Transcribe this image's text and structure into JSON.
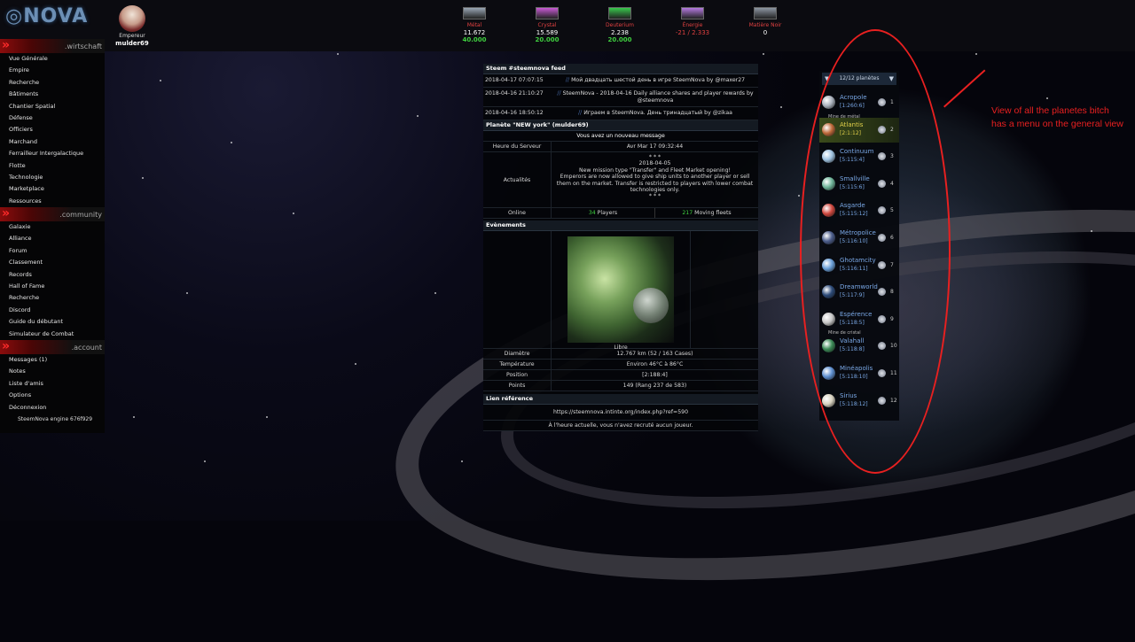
{
  "header": {
    "logo": "NOVA",
    "user_rank": "Empereur",
    "username": "mulder69",
    "resources": [
      {
        "name": "Métal",
        "value": "11.672",
        "prod": "40.000",
        "color": "#9aa7b5",
        "icon": "metal-icon"
      },
      {
        "name": "Crystal",
        "value": "15.589",
        "prod": "20.000",
        "color": "#c95ad4",
        "icon": "crystal-icon"
      },
      {
        "name": "Deuterium",
        "value": "2.238",
        "prod": "20.000",
        "color": "#38c94c",
        "icon": "deuterium-icon"
      },
      {
        "name": "Énergie",
        "value": "-21 / 2.333",
        "prod": "",
        "color": "#b57ae0",
        "icon": "energy-icon"
      },
      {
        "name": "Matière Noir",
        "value": "0",
        "prod": "",
        "color": "#8d96a2",
        "icon": "dark-matter-icon"
      }
    ]
  },
  "sidebar": {
    "sections": [
      {
        "label": ".wirtschaft",
        "items": [
          "Vue Générale",
          "Empire",
          "Recherche",
          "Bâtiments",
          "Chantier Spatial",
          "Défense",
          "Officiers",
          "Marchand",
          "Ferrailleur Intergalactique",
          "Flotte",
          "Technologie",
          "Marketplace",
          "Ressources"
        ]
      },
      {
        "label": ".community",
        "items": [
          "Galaxie",
          "Alliance",
          "Forum",
          "Classement",
          "Records",
          "Hall of Fame",
          "Recherche",
          "Discord",
          "Guide du débutant",
          "Simulateur de Combat"
        ]
      },
      {
        "label": ".account",
        "items": [
          "Messages (1)",
          "Notes",
          "Liste d'amis",
          "Options",
          "Déconnexion"
        ]
      }
    ],
    "engine": "SteemNova engine 676f929"
  },
  "feed": {
    "title": "Steem #steemnova feed",
    "entries": [
      {
        "date": "2018-04-17 07:07:15",
        "text": "Мой двадцать шестой день в игре SteemNova by @maxer27"
      },
      {
        "date": "2018-04-16 21:10:27",
        "text": "SteemNova - 2018-04-16 Daily alliance shares and player rewards by @steemnova"
      },
      {
        "date": "2018-04-16 18:50:12",
        "text": "Играем в SteemNova. День тринадцатый by @zikaa"
      }
    ]
  },
  "planet_info": {
    "title": "Planète \"NEW york\" (mulder69)",
    "new_message": "Vous avez un nouveau message",
    "server_time_label": "Heure du Serveur",
    "server_time": "Avr Mar 17 09:32:44",
    "news_label": "Actualités",
    "news_stars": "* * *",
    "news_date": "2018-04-05",
    "news_line1": "New mission type \"Transfer\" and Fleet Market opening!",
    "news_line2": "Emperors are now allowed to give ship units to another player or sell them on the market. Transfer is restricted to players with lower combat technologies only.",
    "online_label": "Online",
    "players_count": "34",
    "players_label": "Players",
    "fleets_count": "217",
    "fleets_label": "Moving fleets"
  },
  "events": {
    "title": "Evènements",
    "slot_status": "Libre",
    "details": [
      {
        "label": "Diamètre",
        "value": "12.767 km (52 / 163 Cases)"
      },
      {
        "label": "Température",
        "value": "Environ 46°C à 86°C"
      },
      {
        "label": "Position",
        "value": "[2:188:4]"
      },
      {
        "label": "Points",
        "value": "149 (Rang 237 de 583)"
      }
    ]
  },
  "referral": {
    "title": "Lien référence",
    "link": "https://steemnova.intinte.org/index.php?ref=590",
    "status": "À l'heure actuelle, vous n'avez recruté aucun joueur."
  },
  "planet_list": {
    "selector": "12/12 planètes",
    "planets": [
      {
        "name": "Acropole",
        "coord": "[1:260:6]",
        "num": "1",
        "note": "",
        "color": "#aab2bd",
        "active": false
      },
      {
        "name": "Atlantis",
        "coord": "[2:1:12]",
        "num": "2",
        "note": "Mine de métal",
        "color": "#c06a3a",
        "active": true
      },
      {
        "name": "Continuum",
        "coord": "[5:115:4]",
        "num": "3",
        "note": "",
        "color": "#9fc2e0",
        "active": false
      },
      {
        "name": "Smallville",
        "coord": "[5:115:6]",
        "num": "4",
        "note": "",
        "color": "#6fb59a",
        "active": false
      },
      {
        "name": "Asgarde",
        "coord": "[5:115:12]",
        "num": "5",
        "note": "",
        "color": "#d0483f",
        "active": false
      },
      {
        "name": "Métropolice",
        "coord": "[5:116:10]",
        "num": "6",
        "note": "",
        "color": "#4b5c8a",
        "active": false
      },
      {
        "name": "Ghotamcity",
        "coord": "[5:116:11]",
        "num": "7",
        "note": "",
        "color": "#6a9fd8",
        "active": false
      },
      {
        "name": "Dreamworld",
        "coord": "[5:117:9]",
        "num": "8",
        "note": "",
        "color": "#2c4a78",
        "active": false
      },
      {
        "name": "Espérence",
        "coord": "[5:118:5]",
        "num": "9",
        "note": "",
        "color": "#c7c7c7",
        "active": false
      },
      {
        "name": "Valahall",
        "coord": "[5:118:8]",
        "num": "10",
        "note": "Mine de cristal",
        "color": "#3b8a56",
        "active": false
      },
      {
        "name": "Minéapolis",
        "coord": "[5:118:10]",
        "num": "11",
        "note": "",
        "color": "#5e8fd0",
        "active": false
      },
      {
        "name": "Sirius",
        "coord": "[5:118:12]",
        "num": "12",
        "note": "",
        "color": "#d8d2c0",
        "active": false
      }
    ]
  },
  "annotation": "View of all the planetes bitch has a menu on the general view"
}
